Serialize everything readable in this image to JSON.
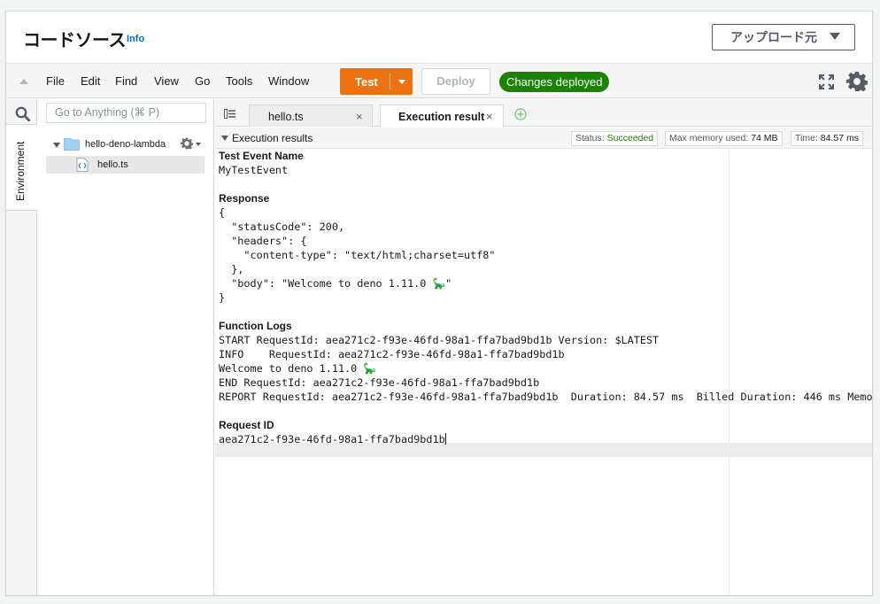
{
  "header": {
    "title": "コードソース",
    "info_label": "Info",
    "upload_label": "アップロード元"
  },
  "toolbar": {
    "menu": [
      "File",
      "Edit",
      "Find",
      "View",
      "Go",
      "Tools",
      "Window"
    ],
    "test_label": "Test",
    "deploy_label": "Deploy",
    "deployed_badge": "Changes deployed"
  },
  "sidebar": {
    "environment_tab": "Environment",
    "search_placeholder": "Go to Anything (⌘ P)",
    "tree": {
      "root": "hello-deno-lambda",
      "files": [
        "hello.ts"
      ]
    }
  },
  "editor": {
    "tabs": [
      {
        "label": "hello.ts",
        "active": false
      },
      {
        "label": "Execution results",
        "active": true
      }
    ],
    "results_header": "Execution results",
    "status": {
      "label": "Status:",
      "value": "Succeeded"
    },
    "memory": {
      "label": "Max memory used:",
      "value": "74 MB"
    },
    "time": {
      "label": "Time:",
      "value": "84.57 ms"
    },
    "output": {
      "event_name_heading": "Test Event Name",
      "event_name": "MyTestEvent",
      "response_heading": "Response",
      "response_lines": [
        "{",
        "  \"statusCode\": 200,",
        "  \"headers\": {",
        "    \"content-type\": \"text/html;charset=utf8\"",
        "  },",
        "  \"body\": \"Welcome to deno 1.11.0 🦕\"",
        "}"
      ],
      "logs_heading": "Function Logs",
      "log_lines": [
        "START RequestId: aea271c2-f93e-46fd-98a1-ffa7bad9bd1b Version: $LATEST",
        "INFO    RequestId: aea271c2-f93e-46fd-98a1-ffa7bad9bd1b",
        "Welcome to deno 1.11.0 🦕",
        "END RequestId: aea271c2-f93e-46fd-98a1-ffa7bad9bd1b",
        "REPORT RequestId: aea271c2-f93e-46fd-98a1-ffa7bad9bd1b  Duration: 84.57 ms  Billed Duration: 446 ms Memo"
      ],
      "request_id_heading": "Request ID",
      "request_id": "aea271c2-f93e-46fd-98a1-ffa7bad9bd1b"
    }
  },
  "colors": {
    "test_button": "#ec7211",
    "deployed_badge": "#1d8102",
    "info_link": "#0073bb",
    "folder": "#9fd0f4"
  },
  "icons": [
    "collapse-icon",
    "expand-icon",
    "gear-icon",
    "search-icon",
    "folder-icon",
    "typescript-file-icon",
    "tabs-list-icon",
    "close-icon",
    "add-tab-icon"
  ]
}
